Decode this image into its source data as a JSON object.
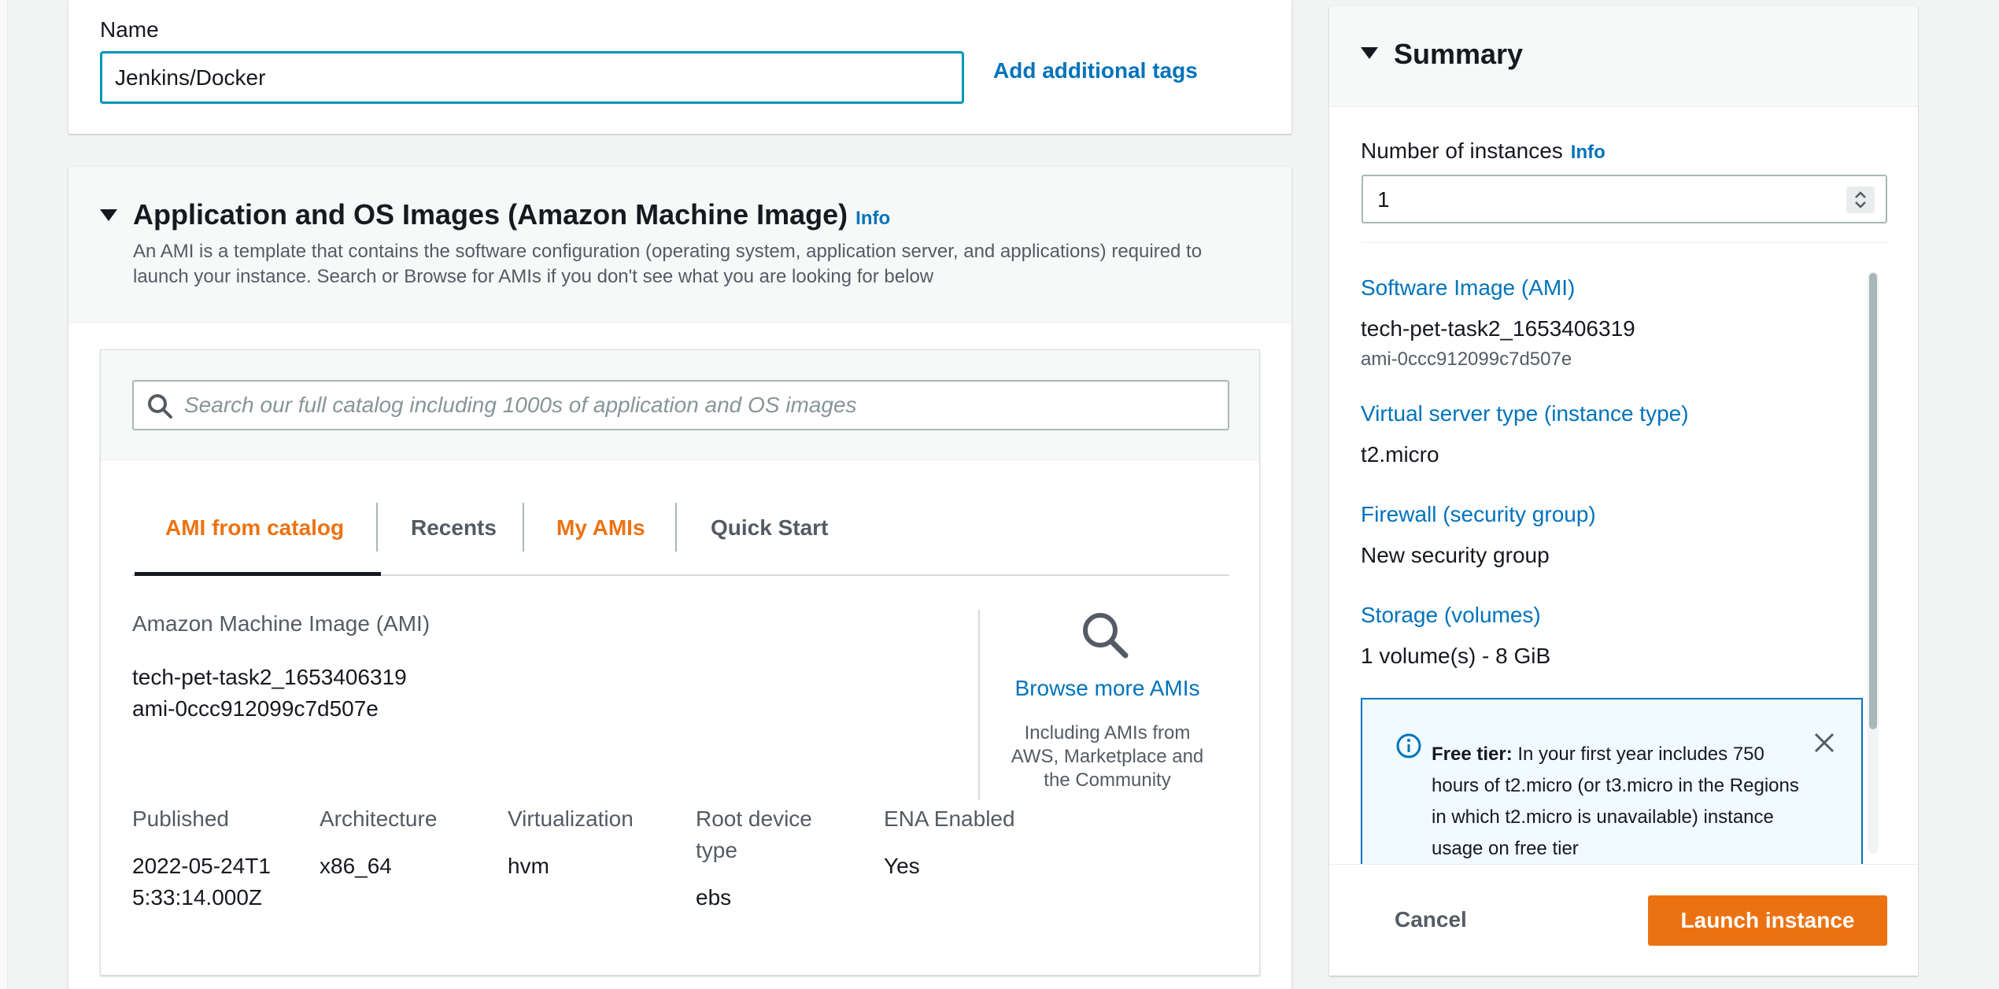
{
  "name_section": {
    "label": "Name",
    "value": "Jenkins/Docker",
    "add_tags_link": "Add additional tags"
  },
  "ami_section": {
    "title": "Application and OS Images (Amazon Machine Image)",
    "info_link": "Info",
    "description_line1": "An AMI is a template that contains the software configuration (operating system, application server, and applications) required to",
    "description_line2": "launch your instance. Search or Browse for AMIs if you don't see what you are looking for below",
    "search_placeholder": "Search our full catalog including 1000s of application and OS images",
    "tabs": [
      {
        "label": "AMI from catalog",
        "color": "#ec7211",
        "selected": true
      },
      {
        "label": "Recents",
        "color": "#545b64",
        "selected": false
      },
      {
        "label": "My AMIs",
        "color": "#ec7211",
        "selected": false
      },
      {
        "label": "Quick Start",
        "color": "#545b64",
        "selected": false
      }
    ],
    "ami_label": "Amazon Machine Image (AMI)",
    "ami_name": "tech-pet-task2_1653406319",
    "ami_id": "ami-0ccc912099c7d507e",
    "browse_link": "Browse more AMIs",
    "browse_note_line1": "Including AMIs from",
    "browse_note_line2": "AWS, Marketplace and",
    "browse_note_line3": "the Community",
    "details": {
      "published_label": "Published",
      "published_value_line1": "2022-05-24T1",
      "published_value_line2": "5:33:14.000Z",
      "architecture_label": "Architecture",
      "architecture_value": "x86_64",
      "virtualization_label": "Virtualization",
      "virtualization_value": "hvm",
      "root_device_label_line1": "Root device",
      "root_device_label_line2": "type",
      "root_device_value": "ebs",
      "ena_label": "ENA Enabled",
      "ena_value": "Yes"
    }
  },
  "summary": {
    "title": "Summary",
    "instances_label": "Number of instances",
    "instances_info": "Info",
    "instances_value": "1",
    "software_image_label": "Software Image (AMI)",
    "software_image_name": "tech-pet-task2_1653406319",
    "software_image_id": "ami-0ccc912099c7d507e",
    "instance_type_label": "Virtual server type (instance type)",
    "instance_type_value": "t2.micro",
    "firewall_label": "Firewall (security group)",
    "firewall_value": "New security group",
    "storage_label": "Storage (volumes)",
    "storage_value": "1 volume(s) - 8 GiB",
    "free_tier_title": "Free tier:",
    "free_tier_text": "In your first year includes 750 hours of t2.micro (or t3.micro in the Regions in which t2.micro is unavailable) instance usage on free tier",
    "cancel_label": "Cancel",
    "launch_label": "Launch instance"
  },
  "colors": {
    "accent_orange": "#ec7211",
    "link_blue": "#0073bb",
    "focus_teal": "#0097b8"
  }
}
